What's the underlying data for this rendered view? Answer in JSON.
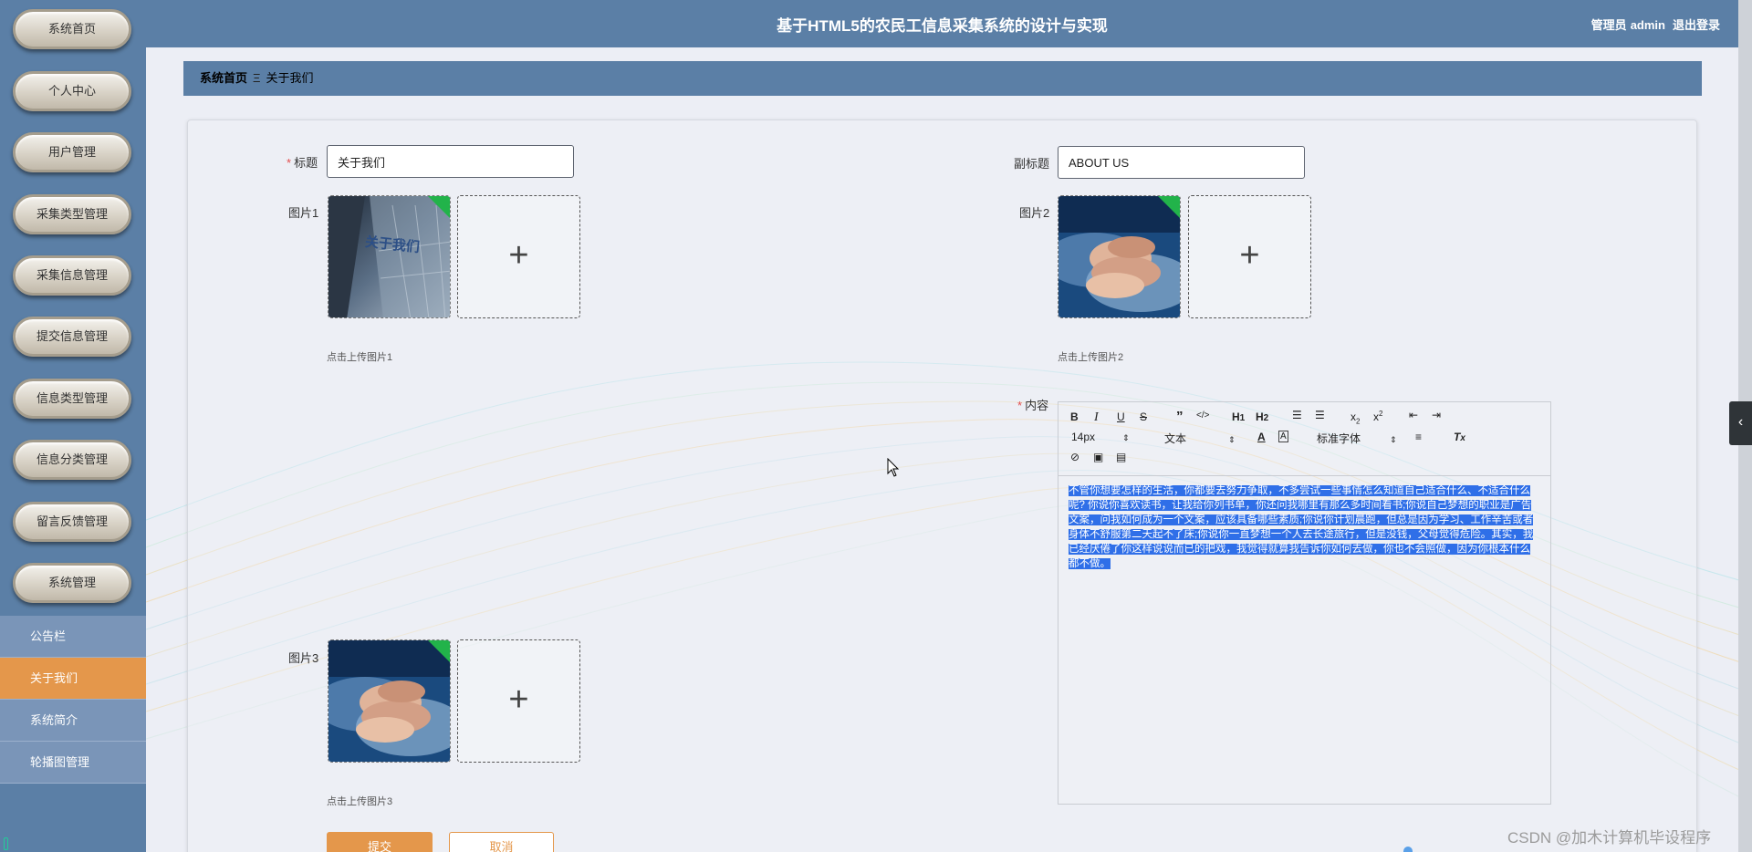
{
  "header": {
    "title": "基于HTML5的农民工信息采集系统的设计与实现",
    "user_role": "管理员",
    "username": "admin",
    "logout_label": "退出登录"
  },
  "sidebar": {
    "items": [
      {
        "label": "系统首页"
      },
      {
        "label": "个人中心"
      },
      {
        "label": "用户管理"
      },
      {
        "label": "采集类型管理"
      },
      {
        "label": "采集信息管理"
      },
      {
        "label": "提交信息管理"
      },
      {
        "label": "信息类型管理"
      },
      {
        "label": "信息分类管理"
      },
      {
        "label": "留言反馈管理"
      },
      {
        "label": "系统管理"
      }
    ],
    "sub_items": [
      {
        "label": "公告栏",
        "active": false
      },
      {
        "label": "关于我们",
        "active": true
      },
      {
        "label": "系统简介",
        "active": false
      },
      {
        "label": "轮播图管理",
        "active": false
      }
    ]
  },
  "breadcrumb": {
    "home": "系统首页",
    "separator": "Ξ",
    "current": "关于我们"
  },
  "form": {
    "title_label": "标题",
    "title_value": "关于我们",
    "subtitle_label": "副标题",
    "subtitle_value": "ABOUT US",
    "image1_label": "图片1",
    "image1_hint": "点击上传图片1",
    "image2_label": "图片2",
    "image2_hint": "点击上传图片2",
    "image3_label": "图片3",
    "image3_hint": "点击上传图片3",
    "content_label": "内容",
    "thumb1_text": "关于我们"
  },
  "editor": {
    "font_size": "14px",
    "paragraph": "文本",
    "font_family": "标准字体",
    "content": "不管你想要怎样的生活，你都要去努力争取，不多尝试一些事情怎么知道自己适合什么、不适合什么呢? 你说你喜欢读书，让我给你列书单，你还问我哪里有那么多时间看书;你说自己梦想的职业是广告文案，问我如何成为一个文案，应该具备哪些素质;你说你计划晨跑，但总是因为学习、工作辛苦或者身体不舒服第二天起不了床;你说你一直梦想一个人去长途旅行，但是没钱，父母觉得危险。其实，我已经厌倦了你这样说说而已的把戏，我觉得就算我告诉你如何去做，你也不会照做，因为你根本什么都不做。"
  },
  "buttons": {
    "submit": "提交",
    "cancel": "取消"
  },
  "watermark": "CSDN @加木计算机毕设程序",
  "colors": {
    "primary": "#5b7fa6",
    "accent": "#e4974b",
    "required": "#e34d4d",
    "selection": "#2f6fe8",
    "corner_badge": "#22b34a"
  },
  "icons": [
    "plus-icon",
    "bold-icon",
    "italic-icon",
    "underline-icon",
    "strikethrough-icon",
    "quote-icon",
    "code-icon",
    "heading1-icon",
    "heading2-icon",
    "ordered-list-icon",
    "bullet-list-icon",
    "subscript-icon",
    "superscript-icon",
    "outdent-icon",
    "indent-icon",
    "font-color-icon",
    "background-color-icon",
    "align-icon",
    "clear-format-icon",
    "link-icon",
    "image-icon",
    "video-icon",
    "chevron-left-icon",
    "mouse-pointer-icon"
  ]
}
